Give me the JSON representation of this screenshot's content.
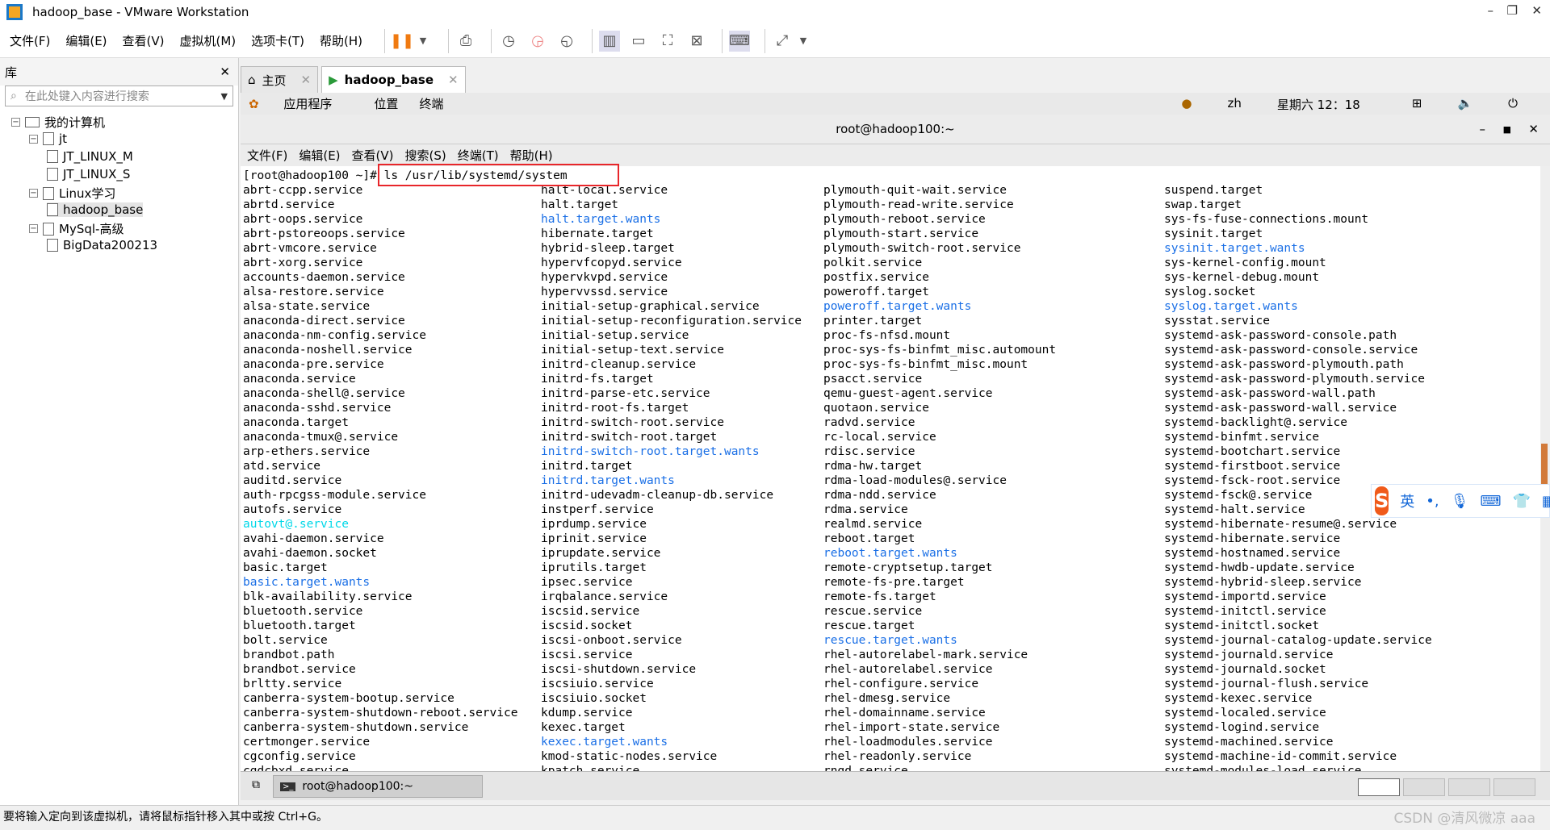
{
  "window": {
    "title": "hadoop_base - VMware Workstation",
    "min": "–",
    "max": "❐",
    "close": "✕"
  },
  "menu": [
    "文件(F)",
    "编辑(E)",
    "查看(V)",
    "虚拟机(M)",
    "选项卡(T)",
    "帮助(H)"
  ],
  "library": {
    "title": "库",
    "close": "✕",
    "search_placeholder": "在此处键入内容进行搜索",
    "tree": [
      {
        "label": "我的计算机",
        "level": 0,
        "exp": "−"
      },
      {
        "label": "jt",
        "level": 1,
        "exp": "−"
      },
      {
        "label": "JT_LINUX_M",
        "level": 2
      },
      {
        "label": "JT_LINUX_S",
        "level": 2
      },
      {
        "label": "Linux学习",
        "level": 1,
        "exp": "−"
      },
      {
        "label": "hadoop_base",
        "level": 2,
        "selected": true
      },
      {
        "label": "MySql-高级",
        "level": 1,
        "exp": "−"
      },
      {
        "label": "BigData200213",
        "level": 2
      }
    ]
  },
  "tabs": [
    {
      "label": "主页"
    },
    {
      "label": "hadoop_base"
    }
  ],
  "gnome": {
    "apps": "应用程序",
    "places": "位置",
    "terminal": "终端",
    "lang": "zh",
    "clock": "星期六 12：18"
  },
  "terminal": {
    "title": "root@hadoop100:~",
    "menu": [
      "文件(F)",
      "编辑(E)",
      "查看(V)",
      "搜索(S)",
      "终端(T)",
      "帮助(H)"
    ],
    "prompt": "[root@hadoop100 ~]# ",
    "command": "ls /usr/lib/systemd/system",
    "colors": {
      "dir": "#1a6fe6",
      "link": "#00d8e8"
    },
    "columns": [
      [
        "abrt-ccpp.service",
        "abrtd.service",
        "abrt-oops.service",
        "abrt-pstoreoops.service",
        "abrt-vmcore.service",
        "abrt-xorg.service",
        "accounts-daemon.service",
        "alsa-restore.service",
        "alsa-state.service",
        "anaconda-direct.service",
        "anaconda-nm-config.service",
        "anaconda-noshell.service",
        "anaconda-pre.service",
        "anaconda.service",
        "anaconda-shell@.service",
        "anaconda-sshd.service",
        "anaconda.target",
        "anaconda-tmux@.service",
        "arp-ethers.service",
        "atd.service",
        "auditd.service",
        "auth-rpcgss-module.service",
        "autofs.service",
        {
          "name": "autovt@.service",
          "type": "link"
        },
        "avahi-daemon.service",
        "avahi-daemon.socket",
        "basic.target",
        {
          "name": "basic.target.wants",
          "type": "dir"
        },
        "blk-availability.service",
        "bluetooth.service",
        "bluetooth.target",
        "bolt.service",
        "brandbot.path",
        "brandbot.service",
        "brltty.service",
        "canberra-system-bootup.service",
        "canberra-system-shutdown-reboot.service",
        "canberra-system-shutdown.service",
        "certmonger.service",
        "cgconfig.service",
        "cgdcbxd.service"
      ],
      [
        "halt-local.service",
        "halt.target",
        {
          "name": "halt.target.wants",
          "type": "dir"
        },
        "hibernate.target",
        "hybrid-sleep.target",
        "hypervfcopyd.service",
        "hypervkvpd.service",
        "hypervvssd.service",
        "initial-setup-graphical.service",
        "initial-setup-reconfiguration.service",
        "initial-setup.service",
        "initial-setup-text.service",
        "initrd-cleanup.service",
        "initrd-fs.target",
        "initrd-parse-etc.service",
        "initrd-root-fs.target",
        "initrd-switch-root.service",
        "initrd-switch-root.target",
        {
          "name": "initrd-switch-root.target.wants",
          "type": "dir"
        },
        "initrd.target",
        {
          "name": "initrd.target.wants",
          "type": "dir"
        },
        "initrd-udevadm-cleanup-db.service",
        "instperf.service",
        "iprdump.service",
        "iprinit.service",
        "iprupdate.service",
        "iprutils.target",
        "ipsec.service",
        "irqbalance.service",
        "iscsid.service",
        "iscsid.socket",
        "iscsi-onboot.service",
        "iscsi.service",
        "iscsi-shutdown.service",
        "iscsiuio.service",
        "iscsiuio.socket",
        "kdump.service",
        "kexec.target",
        {
          "name": "kexec.target.wants",
          "type": "dir"
        },
        "kmod-static-nodes.service",
        "kpatch.service"
      ],
      [
        "plymouth-quit-wait.service",
        "plymouth-read-write.service",
        "plymouth-reboot.service",
        "plymouth-start.service",
        "plymouth-switch-root.service",
        "polkit.service",
        "postfix.service",
        "poweroff.target",
        {
          "name": "poweroff.target.wants",
          "type": "dir"
        },
        "printer.target",
        "proc-fs-nfsd.mount",
        "proc-sys-fs-binfmt_misc.automount",
        "proc-sys-fs-binfmt_misc.mount",
        "psacct.service",
        "qemu-guest-agent.service",
        "quotaon.service",
        "radvd.service",
        "rc-local.service",
        "rdisc.service",
        "rdma-hw.target",
        "rdma-load-modules@.service",
        "rdma-ndd.service",
        "rdma.service",
        "realmd.service",
        "reboot.target",
        {
          "name": "reboot.target.wants",
          "type": "dir"
        },
        "remote-cryptsetup.target",
        "remote-fs-pre.target",
        "remote-fs.target",
        "rescue.service",
        "rescue.target",
        {
          "name": "rescue.target.wants",
          "type": "dir"
        },
        "rhel-autorelabel-mark.service",
        "rhel-autorelabel.service",
        "rhel-configure.service",
        "rhel-dmesg.service",
        "rhel-domainname.service",
        "rhel-import-state.service",
        "rhel-loadmodules.service",
        "rhel-readonly.service",
        "rngd.service"
      ],
      [
        "suspend.target",
        "swap.target",
        "sys-fs-fuse-connections.mount",
        "sysinit.target",
        {
          "name": "sysinit.target.wants",
          "type": "dir"
        },
        "sys-kernel-config.mount",
        "sys-kernel-debug.mount",
        "syslog.socket",
        {
          "name": "syslog.target.wants",
          "type": "dir"
        },
        "sysstat.service",
        "systemd-ask-password-console.path",
        "systemd-ask-password-console.service",
        "systemd-ask-password-plymouth.path",
        "systemd-ask-password-plymouth.service",
        "systemd-ask-password-wall.path",
        "systemd-ask-password-wall.service",
        "systemd-backlight@.service",
        "systemd-binfmt.service",
        "systemd-bootchart.service",
        "systemd-firstboot.service",
        "systemd-fsck-root.service",
        "systemd-fsck@.service",
        "systemd-halt.service",
        "systemd-hibernate-resume@.service",
        "systemd-hibernate.service",
        "systemd-hostnamed.service",
        "systemd-hwdb-update.service",
        "systemd-hybrid-sleep.service",
        "systemd-importd.service",
        "systemd-initctl.service",
        "systemd-initctl.socket",
        "systemd-journal-catalog-update.service",
        "systemd-journald.service",
        "systemd-journald.socket",
        "systemd-journal-flush.service",
        "systemd-kexec.service",
        "systemd-localed.service",
        "systemd-logind.service",
        "systemd-machined.service",
        "systemd-machine-id-commit.service",
        "systemd-modules-load.service"
      ]
    ]
  },
  "taskbar": {
    "item": "root@hadoop100:~"
  },
  "ime": {
    "mode": "英"
  },
  "status": "要将输入定向到该虚拟机，请将鼠标指针移入其中或按 Ctrl+G。",
  "watermark": "CSDN @清风微凉 aaa"
}
